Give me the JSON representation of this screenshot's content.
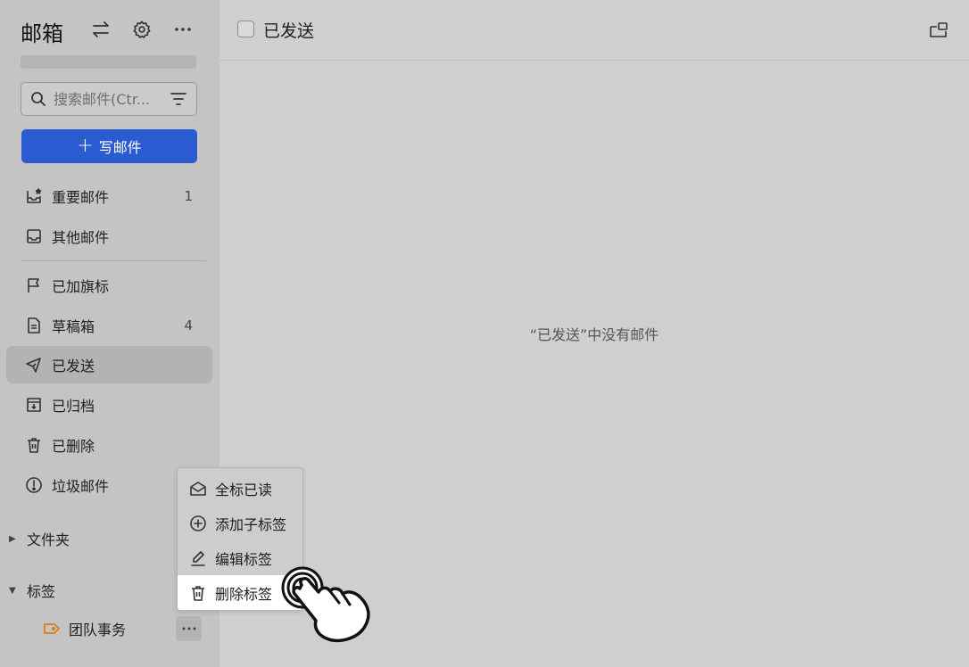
{
  "sidebar": {
    "title": "邮箱",
    "search": {
      "placeholder": "搜索邮件(Ctr..."
    },
    "compose_label": "写邮件",
    "items": [
      {
        "label": "重要邮件",
        "count": "1",
        "icon": "inbox-star-icon"
      },
      {
        "label": "其他邮件",
        "count": "",
        "icon": "inbox-icon"
      },
      {
        "label": "已加旗标",
        "count": "",
        "icon": "flag-icon"
      },
      {
        "label": "草稿箱",
        "count": "4",
        "icon": "draft-icon"
      },
      {
        "label": "已发送",
        "count": "",
        "icon": "send-icon",
        "active": true
      },
      {
        "label": "已归档",
        "count": "",
        "icon": "archive-icon"
      },
      {
        "label": "已删除",
        "count": "",
        "icon": "trash-icon"
      },
      {
        "label": "垃圾邮件",
        "count": "",
        "icon": "spam-icon"
      }
    ],
    "folders_label": "文件夹",
    "tags_label": "标签",
    "tag_items": [
      {
        "label": "团队事务",
        "color": "#e07a1f"
      }
    ]
  },
  "main": {
    "title": "已发送",
    "empty_message": "“已发送”中没有邮件"
  },
  "context_menu": {
    "items": [
      {
        "label": "全标已读",
        "icon": "mail-open-icon"
      },
      {
        "label": "添加子标签",
        "icon": "plus-circle-icon"
      },
      {
        "label": "编辑标签",
        "icon": "pencil-icon"
      },
      {
        "label": "删除标签",
        "icon": "trash-icon",
        "hovered": true
      }
    ]
  },
  "colors": {
    "accent": "#2b5bd1",
    "tag": "#e07a1f"
  }
}
